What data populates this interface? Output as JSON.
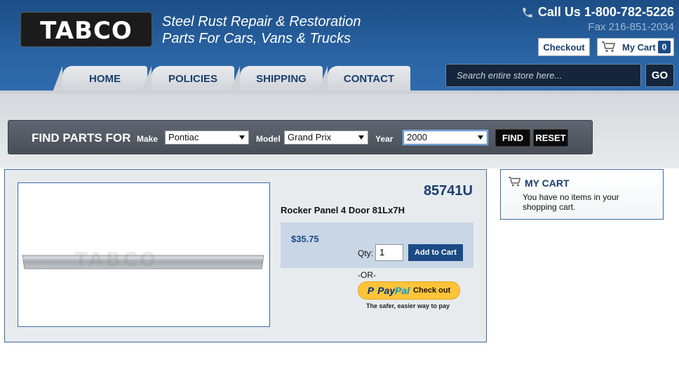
{
  "brand": {
    "logo_text": "TABCO",
    "tagline_line1": "Steel Rust Repair & Restoration",
    "tagline_line2": "Parts For Cars, Vans & Trucks"
  },
  "contact": {
    "phone": "Call Us 1-800-782-5226",
    "fax": "Fax 216-851-2034"
  },
  "header_buttons": {
    "checkout": "Checkout",
    "cart": "My Cart",
    "cart_count": "0"
  },
  "nav": {
    "tabs": [
      "HOME",
      "POLICIES",
      "SHIPPING",
      "CONTACT"
    ]
  },
  "search": {
    "placeholder": "Search entire store here...",
    "go": "GO"
  },
  "find_parts": {
    "title": "FIND PARTS FOR",
    "make_label": "Make",
    "make_value": "Pontiac",
    "model_label": "Model",
    "model_value": "Grand Prix",
    "year_label": "Year",
    "year_value": "2000",
    "find_btn": "FIND",
    "reset_btn": "RESET"
  },
  "product": {
    "sku": "85741U",
    "name": "Rocker Panel 4 Door 81Lx7H",
    "price": "$35.75",
    "qty_label": "Qty:",
    "qty_value": "1",
    "add_to_cart": "Add to Cart",
    "or_text": "-OR-",
    "paypal_pay": "Pay",
    "paypal_pal": "Pal",
    "paypal_checkout": "Check out",
    "paypal_tagline": "The safer, easier way to pay",
    "watermark": "TABCO"
  },
  "my_cart": {
    "title": "MY CART",
    "empty_text": "You have no items in your shopping cart."
  },
  "colors": {
    "header_blue": "#2a64a3",
    "navy": "#1a3f6e",
    "paypal_yellow": "#ffc439"
  }
}
